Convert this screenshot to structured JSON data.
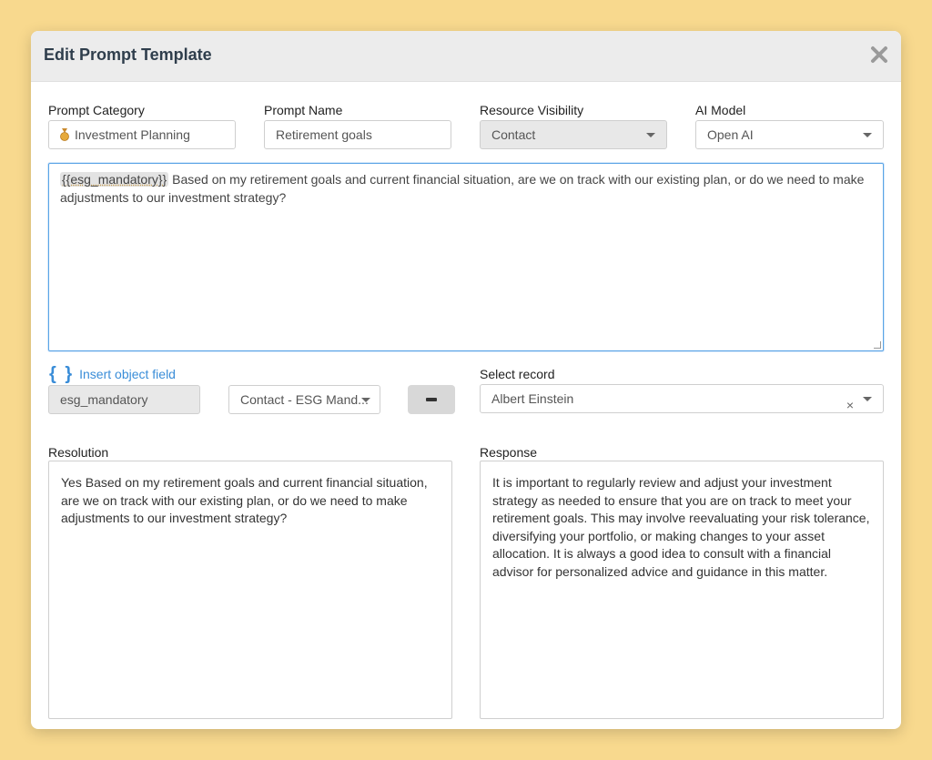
{
  "modal": {
    "title": "Edit Prompt Template",
    "close_icon": "close-icon"
  },
  "fields": {
    "category": {
      "label": "Prompt Category",
      "icon": "medal-icon",
      "value": "Investment Planning"
    },
    "name": {
      "label": "Prompt Name",
      "value": "Retirement goals"
    },
    "visibility": {
      "label": "Resource Visibility",
      "value": "Contact"
    },
    "model": {
      "label": "AI Model",
      "value": "Open AI"
    }
  },
  "prompt": {
    "token": "{{esg_mandatory}}",
    "text": " Based on my retirement goals and current financial situation, are we on track with our existing plan, or do we need to make adjustments to our investment strategy?"
  },
  "insert": {
    "icon": "braces-icon",
    "braces": "{ }",
    "label": "Insert object field",
    "field_value": "esg_mandatory",
    "object_value": "Contact - ESG Mand..."
  },
  "record": {
    "label": "Select record",
    "value": "Albert Einstein",
    "clear": "×"
  },
  "resolution": {
    "label": "Resolution",
    "text": "Yes Based on my retirement goals and current financial situation, are we on track with our existing plan, or do we need to make adjustments to our investment strategy?"
  },
  "response": {
    "label": "Response",
    "text": "It is important to regularly review and adjust your investment strategy as needed to ensure that you are on track to meet your retirement goals. This may involve reevaluating your risk tolerance, diversifying your portfolio, or making changes to your asset allocation. It is always a good idea to consult with a financial advisor for personalized advice and guidance in this matter."
  },
  "colors": {
    "background": "#f8d98e",
    "header": "#ececec",
    "accent": "#3a8dd8",
    "focus_border": "#5aa4e6"
  }
}
